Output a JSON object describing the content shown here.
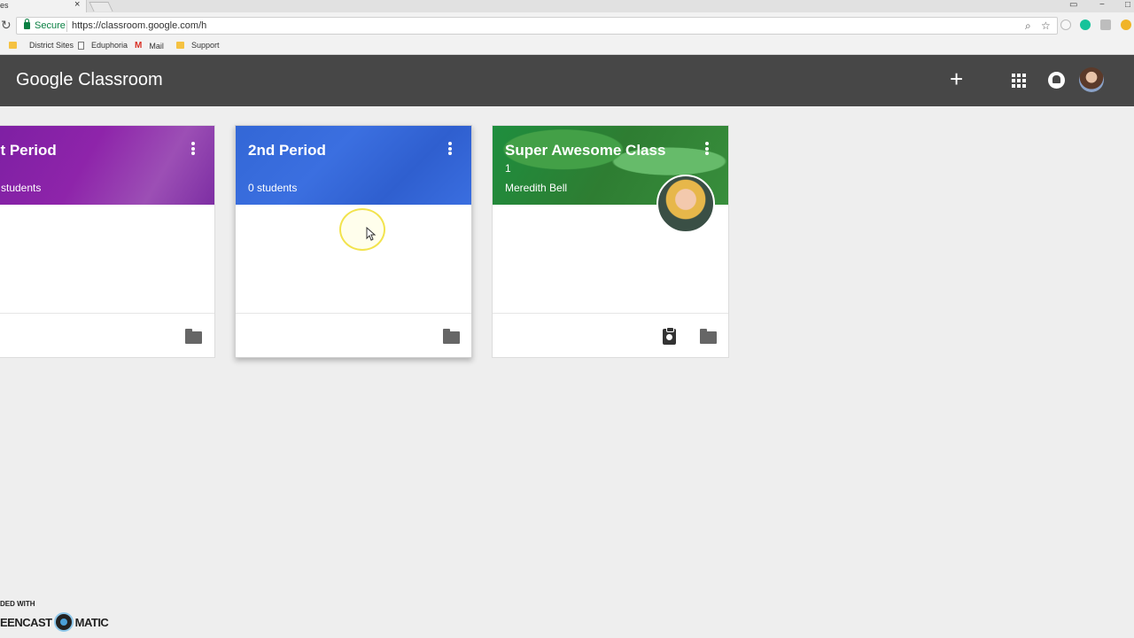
{
  "browser": {
    "tab_title": "es",
    "tab_close": "×",
    "window_controls": [
      "−",
      "□"
    ],
    "secure_label": "Secure",
    "url": "https://classroom.google.com/h",
    "bookmarks": [
      {
        "label": "District Sites",
        "icon": "folder-icon"
      },
      {
        "label": "Eduphoria",
        "icon": "page-icon"
      },
      {
        "label": "Mail",
        "icon": "gmail-icon"
      },
      {
        "label": "Support",
        "icon": "folder-icon"
      }
    ]
  },
  "appbar": {
    "logo_google": "Google",
    "logo_product": "Classroom",
    "add_glyph": "+"
  },
  "classes": [
    {
      "title": "st Period",
      "subtitle": "",
      "meta": "students",
      "color": "#7b1fa2"
    },
    {
      "title": "2nd Period",
      "subtitle": "",
      "meta": "0 students",
      "color": "#3367d6"
    },
    {
      "title": "Super Awesome Class",
      "subtitle": "1",
      "meta": "Meredith Bell",
      "color": "#1e8e3e"
    }
  ],
  "watermark": {
    "top": "DED WITH",
    "left": "EENCAST",
    "right": "MATIC"
  },
  "colors": {
    "appbar": "#474747",
    "background": "#eeeeee",
    "secure_green": "#0b8043"
  }
}
